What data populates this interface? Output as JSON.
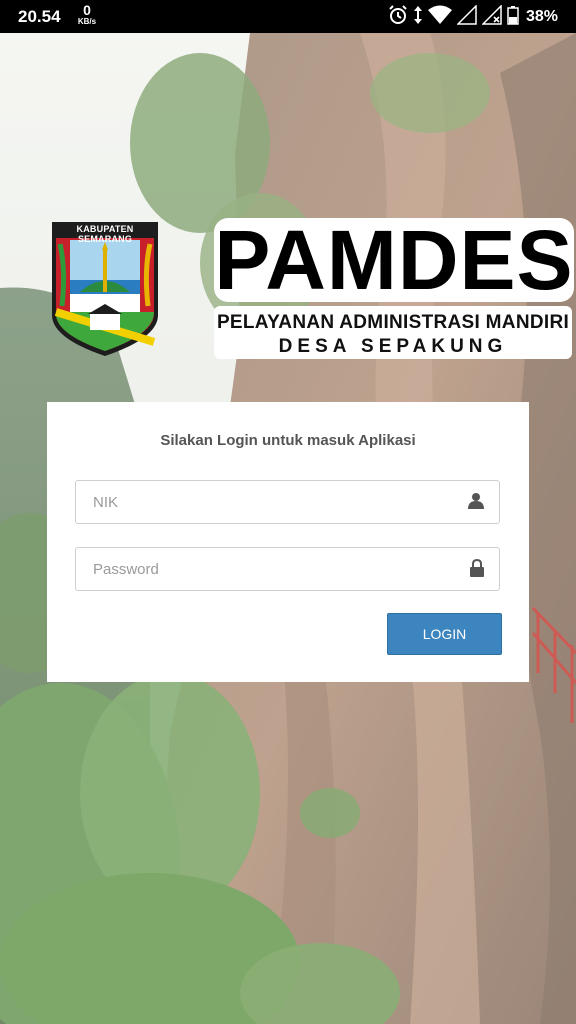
{
  "status_bar": {
    "time": "20.54",
    "net_speed_value": "0",
    "net_speed_unit": "KB/s",
    "battery": "38%",
    "icons": [
      "alarm-icon",
      "data-arrows-icon",
      "wifi-icon",
      "signal-icon",
      "signal-no-service-icon",
      "battery-icon"
    ]
  },
  "logo": {
    "shield_text": "KABUPATEN SEMARANG",
    "title": "PAMDES",
    "subtitle_1": "PELAYANAN ADMINISTRASI MANDIRI",
    "subtitle_2": "DESA SEPAKUNG"
  },
  "login": {
    "heading": "Silakan Login untuk masuk Aplikasi",
    "nik_placeholder": "NIK",
    "nik_value": "",
    "password_placeholder": "Password",
    "password_value": "",
    "button_label": "LOGIN",
    "nik_icon": "user-icon",
    "password_icon": "lock-icon"
  },
  "colors": {
    "button": "#3d85be",
    "status_bar": "#000000",
    "card": "#ffffff"
  }
}
